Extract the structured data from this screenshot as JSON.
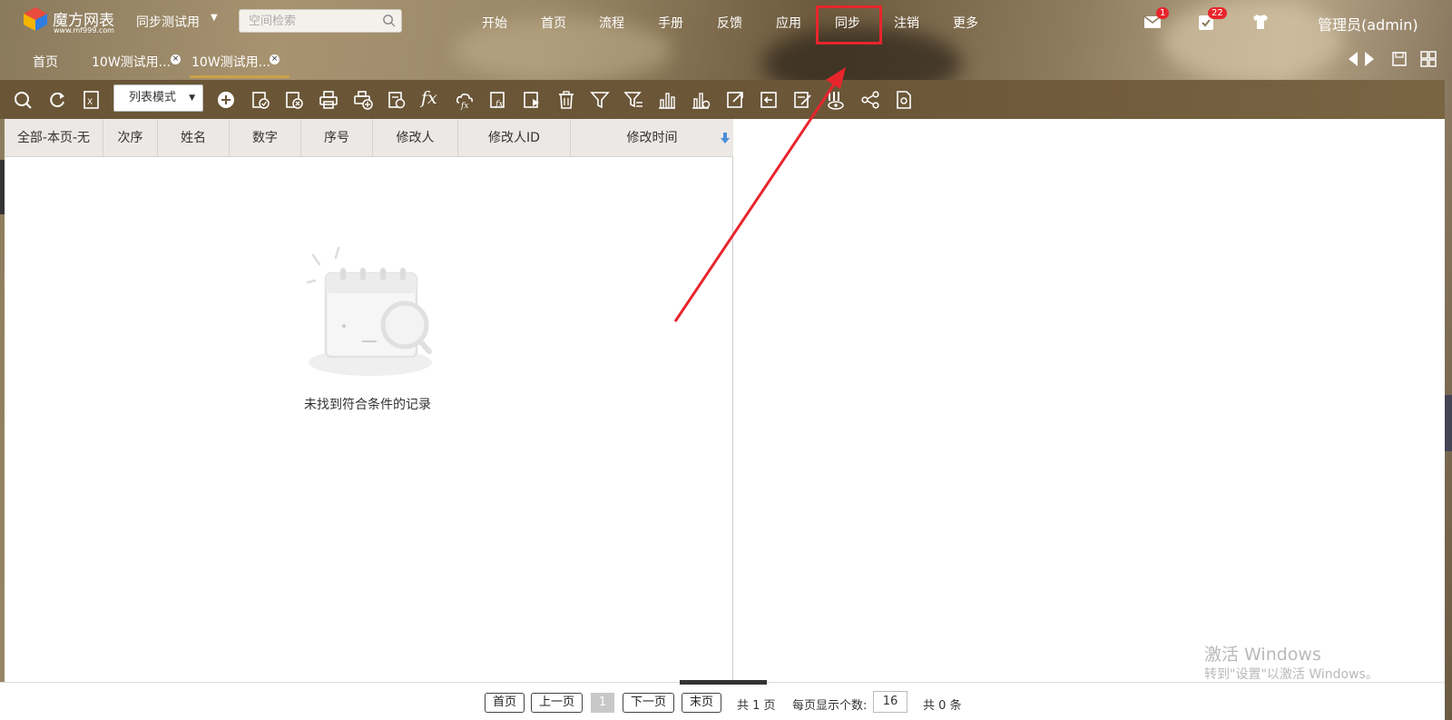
{
  "header": {
    "logo_text": "魔方网表",
    "logo_sub": "www.mf999.com",
    "space_name": "同步测试用",
    "search_placeholder": "空间检索",
    "nav": [
      "开始",
      "首页",
      "流程",
      "手册",
      "反馈",
      "应用",
      "同步",
      "注销",
      "更多"
    ],
    "highlighted_nav": "同步",
    "mail_badge": "1",
    "task_badge": "22",
    "user": "管理员(admin)"
  },
  "tabs": [
    {
      "label": "首页"
    },
    {
      "label": "10W测试用..."
    },
    {
      "label": "10W测试用...",
      "active": true
    }
  ],
  "toolbar": {
    "mode_label": "列表模式",
    "fx_label": "fx"
  },
  "table": {
    "headers": [
      "全部-本页-无",
      "次序",
      "姓名",
      "数字",
      "序号",
      "修改人",
      "修改人ID",
      "修改时间"
    ]
  },
  "empty_message": "未找到符合条件的记录",
  "pager": {
    "first": "首页",
    "prev": "上一页",
    "current": "1",
    "next": "下一页",
    "last": "末页",
    "total_pages": "共 1 页",
    "page_size_label": "每页显示个数:",
    "page_size": "16",
    "total_records": "共 0 条"
  },
  "watermark": {
    "line1": "激活 Windows",
    "line2": "转到\"设置\"以激活 Windows。"
  },
  "colors": {
    "highlight": "#e8252c",
    "toolbar_bg": "#6b5638",
    "tab_active_line": "#c9a24a"
  }
}
